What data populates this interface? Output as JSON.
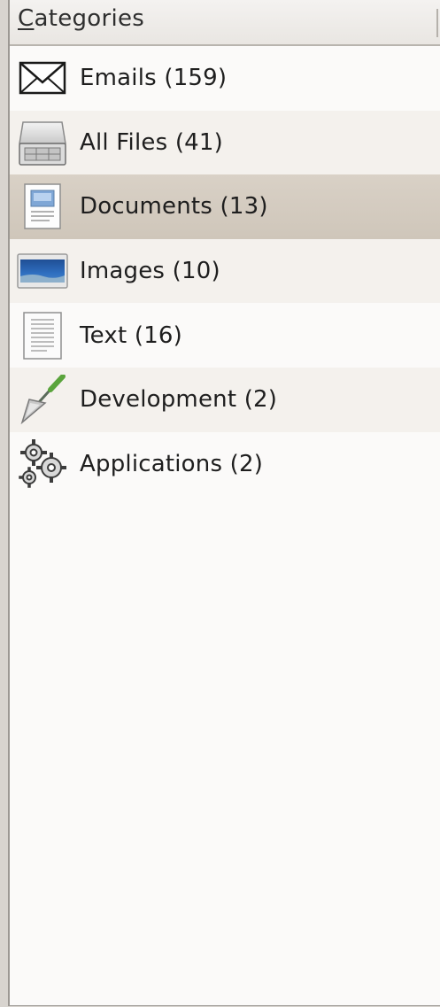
{
  "panel": {
    "header": {
      "mnemonic": "C",
      "rest": "ategories"
    },
    "items": [
      {
        "label": "Emails (159)",
        "icon": "envelope-icon"
      },
      {
        "label": "All Files (41)",
        "icon": "drive-icon"
      },
      {
        "label": "Documents (13)",
        "icon": "document-icon"
      },
      {
        "label": "Images (10)",
        "icon": "image-icon"
      },
      {
        "label": "Text (16)",
        "icon": "text-file-icon"
      },
      {
        "label": "Development (2)",
        "icon": "trowel-icon"
      },
      {
        "label": "Applications (2)",
        "icon": "gears-icon"
      }
    ],
    "selected_index": 2,
    "colors": {
      "selected": "#d3cabe",
      "alt_row": "#f4f1ed",
      "background": "#fbfaf9"
    }
  }
}
